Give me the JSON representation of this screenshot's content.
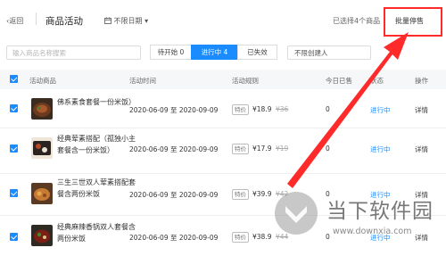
{
  "topbar": {
    "back": "‹返回",
    "title": "商品活动",
    "date_icon": "calendar-icon",
    "date_filter": "不限日期 ▾",
    "selected": "已选择4个商品",
    "batch": "批量停售"
  },
  "filters": {
    "search_placeholder": "输入商品名称搜索",
    "tabs": [
      {
        "label": "待开始 0",
        "active": false
      },
      {
        "label": "进行中 4",
        "active": true
      },
      {
        "label": "已失效",
        "active": false
      }
    ],
    "creator": "不限创建人"
  },
  "table": {
    "headers": {
      "product": "活动商品",
      "time": "活动时间",
      "rule": "活动规则",
      "sold": "今日已售",
      "status": "状态",
      "op": "操作"
    },
    "rows": [
      {
        "name": "佛系素食套餐一份米饭）",
        "time": "2020-06-09 至 2020-09-09",
        "tag": "特价",
        "price": "¥18.9",
        "old": "¥36",
        "sold": "0",
        "status": "进行中",
        "action": "详情"
      },
      {
        "name": "经典荤素搭配（孤独小主套餐含一份米饭）",
        "time": "2020-06-09 至 2020-09-09",
        "tag": "特价",
        "price": "¥17.9",
        "old": "¥19",
        "sold": "0",
        "status": "进行中",
        "action": "详情"
      },
      {
        "name": "三生三世双人荤素搭配套餐含两份米饭",
        "time": "2020-06-09 至 2020-09-09",
        "tag": "特价",
        "price": "¥39.9",
        "old": "¥42",
        "sold": "0",
        "status": "进行中",
        "action": "详情"
      },
      {
        "name": "经典麻辣香锅双人套餐含两份米饭",
        "time": "2020-06-09 至 2020-09-09",
        "tag": "特价",
        "price": "¥38.9",
        "old": "¥44",
        "sold": "0",
        "status": "进行中",
        "action": "详情"
      }
    ]
  },
  "watermark": {
    "brand": "当下软件园",
    "url": "www.downxia.com"
  },
  "colors": {
    "accent": "#1a8cff",
    "annotation": "#ff2b2b"
  }
}
